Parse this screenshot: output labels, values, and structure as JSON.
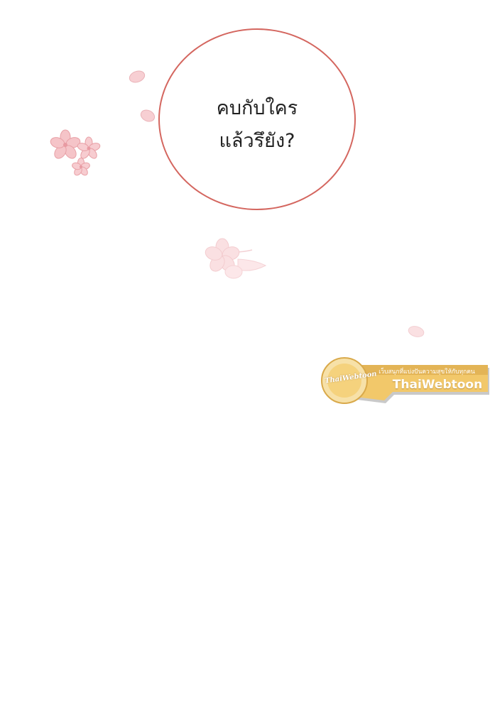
{
  "speech_bubble": {
    "line1": "คบกับใคร",
    "line2": "แล้วรึยัง?",
    "border_color": "#d4665f"
  },
  "decorations": {
    "petal_color": "#f6c9cc",
    "petal_outline": "#e9a9ae",
    "items": [
      "cherry-blossom-cluster-icon",
      "petal-icon",
      "petal-icon",
      "blossom-branch-icon",
      "petal-icon"
    ]
  },
  "watermark": {
    "tagline": "เว็บสนุกที่แบ่งปันความสุขให้กับทุกคน",
    "brand": "ThaiWebtoon",
    "logo_text": "ThaiWebtoon",
    "colors": {
      "gold": "#f2c86a",
      "gold_dark": "#d9a94a",
      "grey": "#bdbdbd"
    }
  }
}
